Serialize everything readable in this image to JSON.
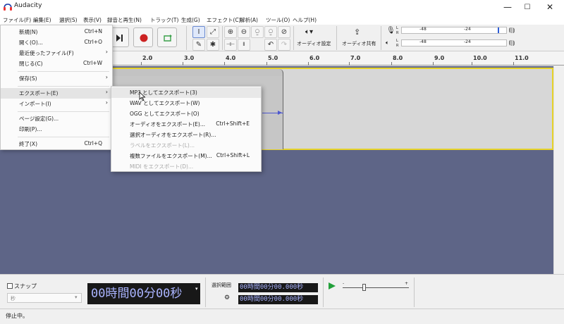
{
  "window": {
    "title": "Audacity",
    "controls": {
      "minimize": "—",
      "maximize": "☐",
      "close": "✕"
    }
  },
  "menubar": [
    "ファイル(F)",
    "編集(E)",
    "選択(S)",
    "表示(V)",
    "録音と再生(N)",
    "トラック(T)",
    "生成(G)",
    "エフェクト(C)",
    "解析(A)",
    "ツール(O)",
    "ヘルプ(H)"
  ],
  "file_menu": {
    "items": [
      {
        "label": "新規(N)",
        "shortcut": "Ctrl+N",
        "submenu": false
      },
      {
        "label": "開く(O)...",
        "shortcut": "Ctrl+O",
        "submenu": false
      },
      {
        "label": "最近使ったファイル(F)",
        "shortcut": "",
        "submenu": true
      },
      {
        "label": "閉じる(C)",
        "shortcut": "Ctrl+W",
        "submenu": false
      },
      {
        "label": "保存(S)",
        "shortcut": "",
        "submenu": true
      },
      {
        "label": "エクスポート(E)",
        "shortcut": "",
        "submenu": true
      },
      {
        "label": "インポート(I)",
        "shortcut": "",
        "submenu": true
      },
      {
        "label": "ページ設定(G)...",
        "shortcut": "",
        "submenu": false
      },
      {
        "label": "印刷(P)...",
        "shortcut": "",
        "submenu": false
      },
      {
        "label": "終了(X)",
        "shortcut": "Ctrl+Q",
        "submenu": false
      }
    ]
  },
  "export_menu": {
    "items": [
      {
        "label": "MP3 としてエクスポート(3)",
        "shortcut": "",
        "enabled": true
      },
      {
        "label": "WAV としてエクスポート(W)",
        "shortcut": "",
        "enabled": true
      },
      {
        "label": "OGG としてエクスポート(O)",
        "shortcut": "",
        "enabled": true
      },
      {
        "label": "オーディオをエクスポート(E)...",
        "shortcut": "Ctrl+Shift+E",
        "enabled": true
      },
      {
        "label": "選択オーディオをエクスポート(R)...",
        "shortcut": "",
        "enabled": true
      },
      {
        "label": "ラベルをエクスポート(L)...",
        "shortcut": "",
        "enabled": false
      },
      {
        "label": "複数ファイルをエクスポート(M)...",
        "shortcut": "Ctrl+Shift+L",
        "enabled": true
      },
      {
        "label": "MIDI をエクスポート(D)...",
        "shortcut": "",
        "enabled": false
      }
    ]
  },
  "toolbar": {
    "audio_settings_label": "オーディオ設定",
    "share_audio_label": "オーディオ共有",
    "meter_l": "L",
    "meter_r": "R",
    "meter_db1": "-48",
    "meter_db2": "-24"
  },
  "ruler": {
    "labels": [
      "2.0",
      "3.0",
      "4.0",
      "5.0",
      "6.0",
      "7.0",
      "8.0",
      "9.0",
      "10.0",
      "11.0"
    ]
  },
  "bottom": {
    "snap_label": "スナップ",
    "snap_unit": "秒",
    "time_display": "00時間00分00秒",
    "selection_label": "選択範囲",
    "selection_start": "00時間00分00.000秒",
    "selection_end": "00時間00分00.000秒"
  },
  "status": {
    "text": "停止中。"
  },
  "colors": {
    "track_bg": "#5e6587",
    "selection_border": "#e6d229",
    "record_red": "#cc2222",
    "play_green": "#22a03a",
    "time_text": "#aab4ff"
  }
}
